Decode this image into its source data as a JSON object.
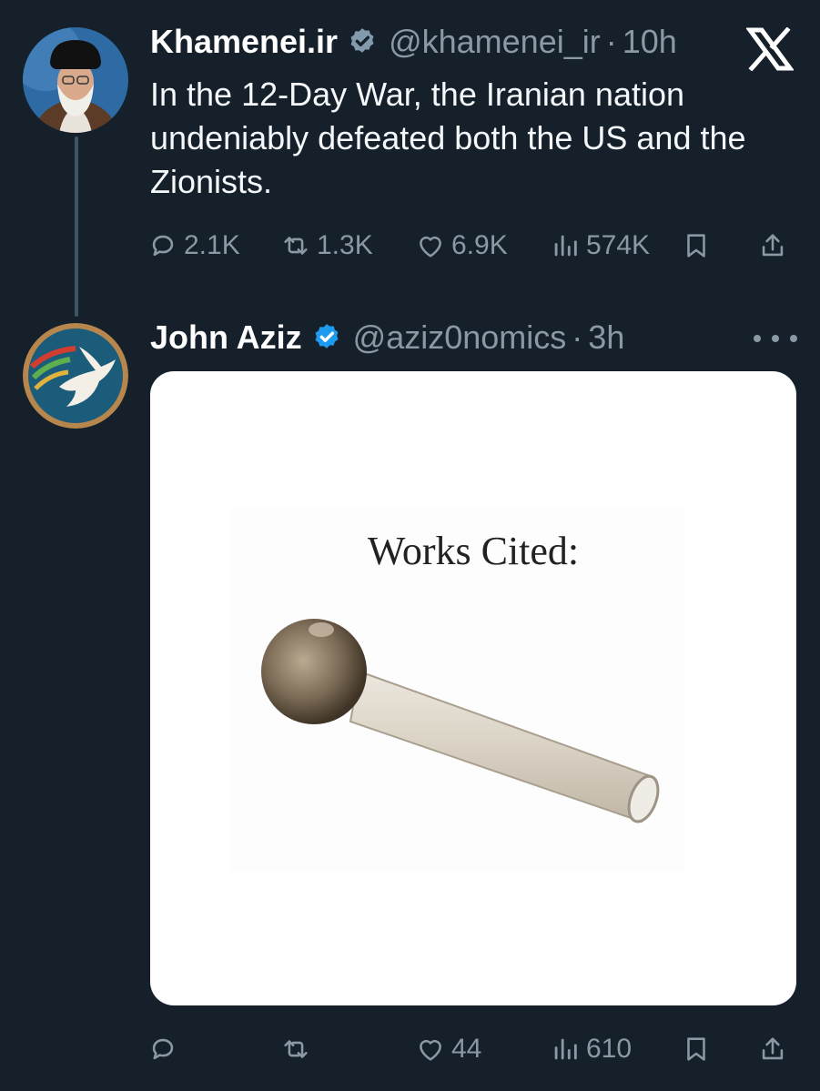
{
  "tweet1": {
    "display_name": "Khamenei.ir",
    "handle": "@khamenei_ir",
    "separator": "·",
    "time": "10h",
    "text": "In the 12-Day War, the Iranian nation undeniably defeated both the US and the Zionists.",
    "actions": {
      "replies": "2.1K",
      "reposts": "1.3K",
      "likes": "6.9K",
      "views": "574K"
    }
  },
  "tweet2": {
    "display_name": "John Aziz",
    "handle": "@aziz0nomics",
    "separator": "·",
    "time": "3h",
    "media_caption": "Works Cited:",
    "actions": {
      "replies": "",
      "reposts": "",
      "likes": "44",
      "views": "610"
    }
  },
  "colors": {
    "background": "#15202b",
    "muted": "#8b98a5",
    "verified_gray": "#829aab",
    "verified_blue": "#1d9bf0"
  },
  "icons": [
    "reply-icon",
    "repost-icon",
    "like-icon",
    "views-icon",
    "bookmark-icon",
    "share-icon",
    "verified-icon",
    "x-logo-icon",
    "more-icon"
  ]
}
